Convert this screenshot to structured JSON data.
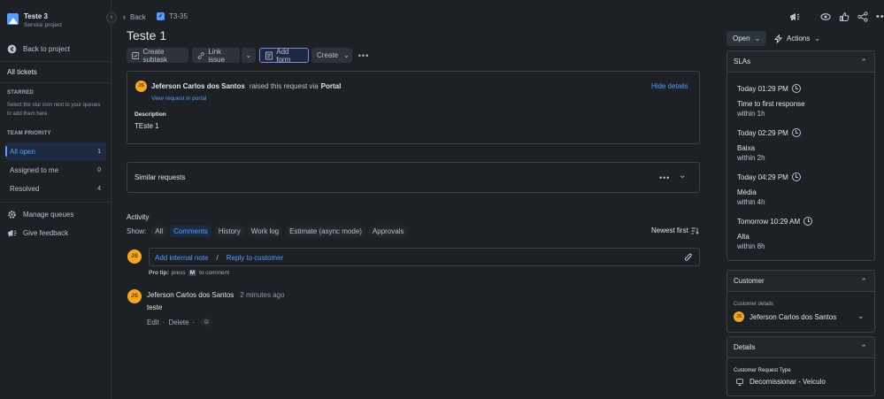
{
  "sidebar": {
    "project_name": "Teste 3",
    "project_type": "Service project",
    "back_to_project": "Back to project",
    "all_tickets": "All tickets",
    "starred_heading": "STARRED",
    "starred_hint": "Select the star icon next to your queues to add them here.",
    "team_priority_heading": "TEAM PRIORITY",
    "queues": [
      {
        "label": "All open",
        "count": "1"
      },
      {
        "label": "Assigned to me",
        "count": "0"
      },
      {
        "label": "Resolved",
        "count": "4"
      }
    ],
    "manage_queues": "Manage queues",
    "give_feedback": "Give feedback"
  },
  "header": {
    "back": "Back",
    "issue_key": "T3-35",
    "title": "Teste 1"
  },
  "toolbar": {
    "create_subtask": "Create subtask",
    "link_issue": "Link issue",
    "add_form": "Add form",
    "create": "Create"
  },
  "request": {
    "reporter": "Jeferson Carlos dos Santos",
    "raised_text": "raised this request via",
    "channel": "Portal",
    "view_in_portal": "View request in portal",
    "hide_details": "Hide details",
    "description_label": "Description",
    "description": "TEste 1",
    "avatar_initials": "JS"
  },
  "similar": {
    "label": "Similar requests"
  },
  "activity": {
    "heading": "Activity",
    "show_label": "Show:",
    "filters": [
      "All",
      "Comments",
      "History",
      "Work log",
      "Estimate (async mode)",
      "Approvals"
    ],
    "sort": "Newest first",
    "add_internal_note": "Add internal note",
    "separator": "/",
    "reply_to_customer": "Reply to customer",
    "pro_tip_label": "Pro tip:",
    "pro_tip_press": "press",
    "pro_tip_key": "M",
    "pro_tip_rest": "to comment",
    "comment_author": "Jeferson Carlos dos Santos",
    "comment_time": "2 minutes ago",
    "comment_text": "teste",
    "edit": "Edit",
    "delete": "Delete",
    "dot": "·"
  },
  "right": {
    "status": "Open",
    "actions": "Actions",
    "slas_heading": "SLAs",
    "slas": [
      {
        "time": "Today 01:29 PM",
        "name": "Time to first response",
        "within": "within 1h"
      },
      {
        "time": "Today 02:29 PM",
        "name": "Baixa",
        "within": "within 2h"
      },
      {
        "time": "Today 04:29 PM",
        "name": "Média",
        "within": "within 4h"
      },
      {
        "time": "Tomorrow 10:29 AM",
        "name": "Alta",
        "within": "within 8h"
      }
    ],
    "customer_heading": "Customer",
    "customer_details_label": "Customer details",
    "customer_name": "Jeferson Carlos dos Santos",
    "details_heading": "Details",
    "request_type_label": "Customer Request Type",
    "request_type": "Decomissionar - Veiculo"
  },
  "icons": {
    "feedback": "megaphone-icon",
    "watch": "eye-icon",
    "vote": "thumbs-up-icon",
    "share": "share-icon",
    "more": "more-icon"
  },
  "colors": {
    "background": "#1d2125",
    "link": "#579dff",
    "avatar": "#f5a623",
    "selected_border": "#8f7ee7"
  }
}
